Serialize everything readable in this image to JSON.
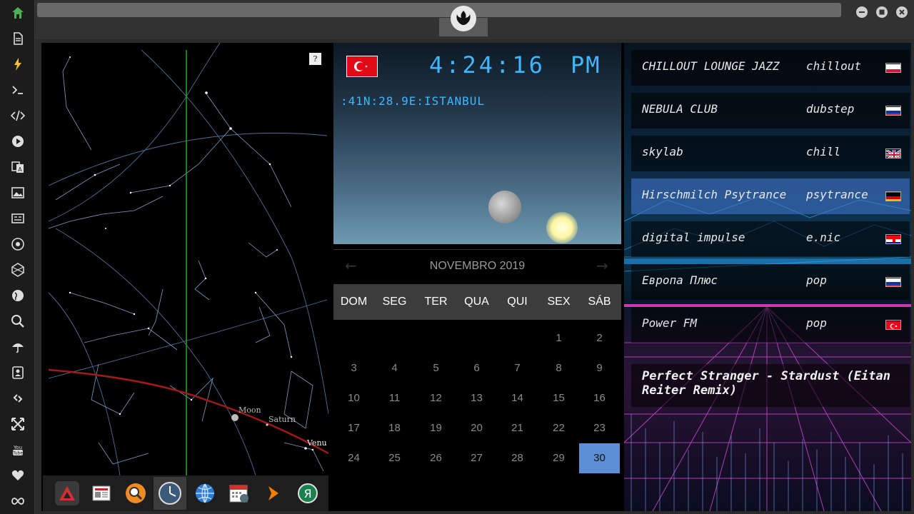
{
  "sidebar": {
    "items": [
      {
        "icon": "home-icon"
      },
      {
        "icon": "document-icon"
      },
      {
        "icon": "lightning-icon"
      },
      {
        "icon": "terminal-icon"
      },
      {
        "icon": "code-icon"
      },
      {
        "icon": "play-icon"
      },
      {
        "icon": "translate-icon"
      },
      {
        "icon": "image-icon"
      },
      {
        "icon": "news-icon"
      },
      {
        "icon": "rebel-icon"
      },
      {
        "icon": "hexagon-icon"
      },
      {
        "icon": "globe-icon"
      },
      {
        "icon": "search-icon"
      },
      {
        "icon": "umbrella-icon"
      },
      {
        "icon": "contact-icon"
      },
      {
        "icon": "link-icon"
      },
      {
        "icon": "expand-icon"
      },
      {
        "icon": "youtube-icon"
      },
      {
        "icon": "heart-icon"
      },
      {
        "icon": "infinity-icon"
      }
    ],
    "accent_color": "#4caf50"
  },
  "starchart": {
    "help_label": "?",
    "labels": {
      "moon": "Moon",
      "saturn": "Saturn",
      "venus": "Venu"
    }
  },
  "dock": {
    "items": [
      {
        "icon": "app-red-triangle-icon"
      },
      {
        "icon": "newspaper-icon"
      },
      {
        "icon": "search-icon"
      },
      {
        "icon": "clock-icon"
      },
      {
        "icon": "globe-icon"
      },
      {
        "icon": "calendar-icon"
      },
      {
        "icon": "chevron-right-icon"
      },
      {
        "icon": "yandex-icon"
      }
    ]
  },
  "clock": {
    "time": "4:24:16",
    "ampm": "PM",
    "location": ":41N:28.9E:ISTANBUL",
    "flag": "turkey-flag",
    "digit_color": "#3fb6ff"
  },
  "calendar": {
    "month_label": "NOVEMBRO 2019",
    "weekdays": [
      "DOM",
      "SEG",
      "TER",
      "QUA",
      "QUI",
      "SEX",
      "SÁB"
    ],
    "days": [
      "1",
      "2",
      "3",
      "4",
      "5",
      "6",
      "7",
      "8",
      "9",
      "10",
      "11",
      "12",
      "13",
      "14",
      "15",
      "16",
      "17",
      "18",
      "19",
      "20",
      "21",
      "22",
      "23",
      "24",
      "25",
      "26",
      "27",
      "28",
      "29",
      "30"
    ],
    "selected": "30",
    "prev_arrow": "←",
    "next_arrow": "→"
  },
  "radio": {
    "stations": [
      {
        "name": "CHILLOUT LOUNGE JAZZ",
        "genre": "chillout",
        "flag": "poland-flag"
      },
      {
        "name": "NEBULA CLUB",
        "genre": "dubstep",
        "flag": "russia-flag"
      },
      {
        "name": "skylab",
        "genre": "chill",
        "flag": "uk-flag"
      },
      {
        "name": "Hirschmilch Psytrance",
        "genre": "psytrance",
        "flag": "germany-flag"
      },
      {
        "name": "digital impulse",
        "genre": "e.nic",
        "flag": "croatia-flag"
      },
      {
        "name": "Европа Плюс",
        "genre": "pop",
        "flag": "russia-flag"
      },
      {
        "name": "Power FM",
        "genre": "pop",
        "flag": "turkey-flag"
      }
    ],
    "now_playing": "Perfect Stranger - Stardust (Eitan Reiter Remix)"
  }
}
